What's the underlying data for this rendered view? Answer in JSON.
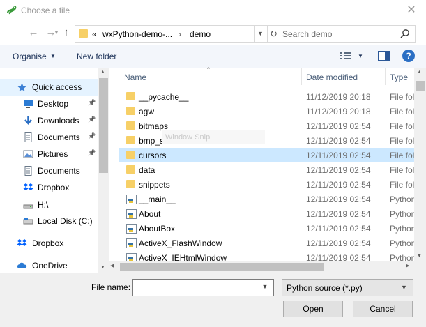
{
  "window": {
    "title": "Choose a file"
  },
  "address": {
    "chevron": "«",
    "crumbs": [
      "wxPython-demo-...",
      "demo"
    ],
    "separator": "›"
  },
  "search": {
    "placeholder": "Search demo"
  },
  "toolbar": {
    "organise": "Organise",
    "new_folder": "New folder",
    "help": "?"
  },
  "nav": {
    "items": [
      {
        "label": "Quick access",
        "icon": "star-icon",
        "pinned": false
      },
      {
        "label": "Desktop",
        "icon": "desktop-icon",
        "pinned": true
      },
      {
        "label": "Downloads",
        "icon": "download-icon",
        "pinned": true
      },
      {
        "label": "Documents",
        "icon": "document-icon",
        "pinned": true
      },
      {
        "label": "Pictures",
        "icon": "pictures-icon",
        "pinned": true
      },
      {
        "label": "Documents",
        "icon": "document-icon",
        "pinned": false
      },
      {
        "label": "Dropbox",
        "icon": "dropbox-icon",
        "pinned": false
      },
      {
        "label": "H:\\",
        "icon": "drive-icon",
        "pinned": false
      },
      {
        "label": "Local Disk (C:)",
        "icon": "disk-icon",
        "pinned": false
      },
      {
        "label": "Dropbox",
        "icon": "dropbox-icon",
        "pinned": false
      },
      {
        "label": "OneDrive",
        "icon": "cloud-icon",
        "pinned": false
      }
    ]
  },
  "list": {
    "columns": {
      "name": "Name",
      "date": "Date modified",
      "type": "Type"
    },
    "rows": [
      {
        "name": "__pycache__",
        "date": "11/12/2019 20:18",
        "type": "File folder",
        "kind": "folder"
      },
      {
        "name": "agw",
        "date": "11/12/2019 20:18",
        "type": "File folder",
        "kind": "folder"
      },
      {
        "name": "bitmaps",
        "date": "12/11/2019 02:54",
        "type": "File folder",
        "kind": "folder"
      },
      {
        "name": "bmp_source",
        "date": "12/11/2019 02:54",
        "type": "File folder",
        "kind": "folder"
      },
      {
        "name": "cursors",
        "date": "12/11/2019 02:54",
        "type": "File folder",
        "kind": "folder"
      },
      {
        "name": "data",
        "date": "12/11/2019 02:54",
        "type": "File folder",
        "kind": "folder"
      },
      {
        "name": "snippets",
        "date": "12/11/2019 02:54",
        "type": "File folder",
        "kind": "folder"
      },
      {
        "name": "__main__",
        "date": "12/11/2019 02:54",
        "type": "Python",
        "kind": "py"
      },
      {
        "name": "About",
        "date": "12/11/2019 02:54",
        "type": "Python",
        "kind": "py"
      },
      {
        "name": "AboutBox",
        "date": "12/11/2019 02:54",
        "type": "Python",
        "kind": "py"
      },
      {
        "name": "ActiveX_FlashWindow",
        "date": "12/11/2019 02:54",
        "type": "Python",
        "kind": "py"
      },
      {
        "name": "ActiveX_IEHtmlWindow",
        "date": "12/11/2019 02:54",
        "type": "Python",
        "kind": "py"
      }
    ],
    "watermark": "Window Snip"
  },
  "footer": {
    "file_name_label": "File name:",
    "file_name_value": "",
    "filter": "Python source (*.py)",
    "open": "Open",
    "cancel": "Cancel"
  }
}
